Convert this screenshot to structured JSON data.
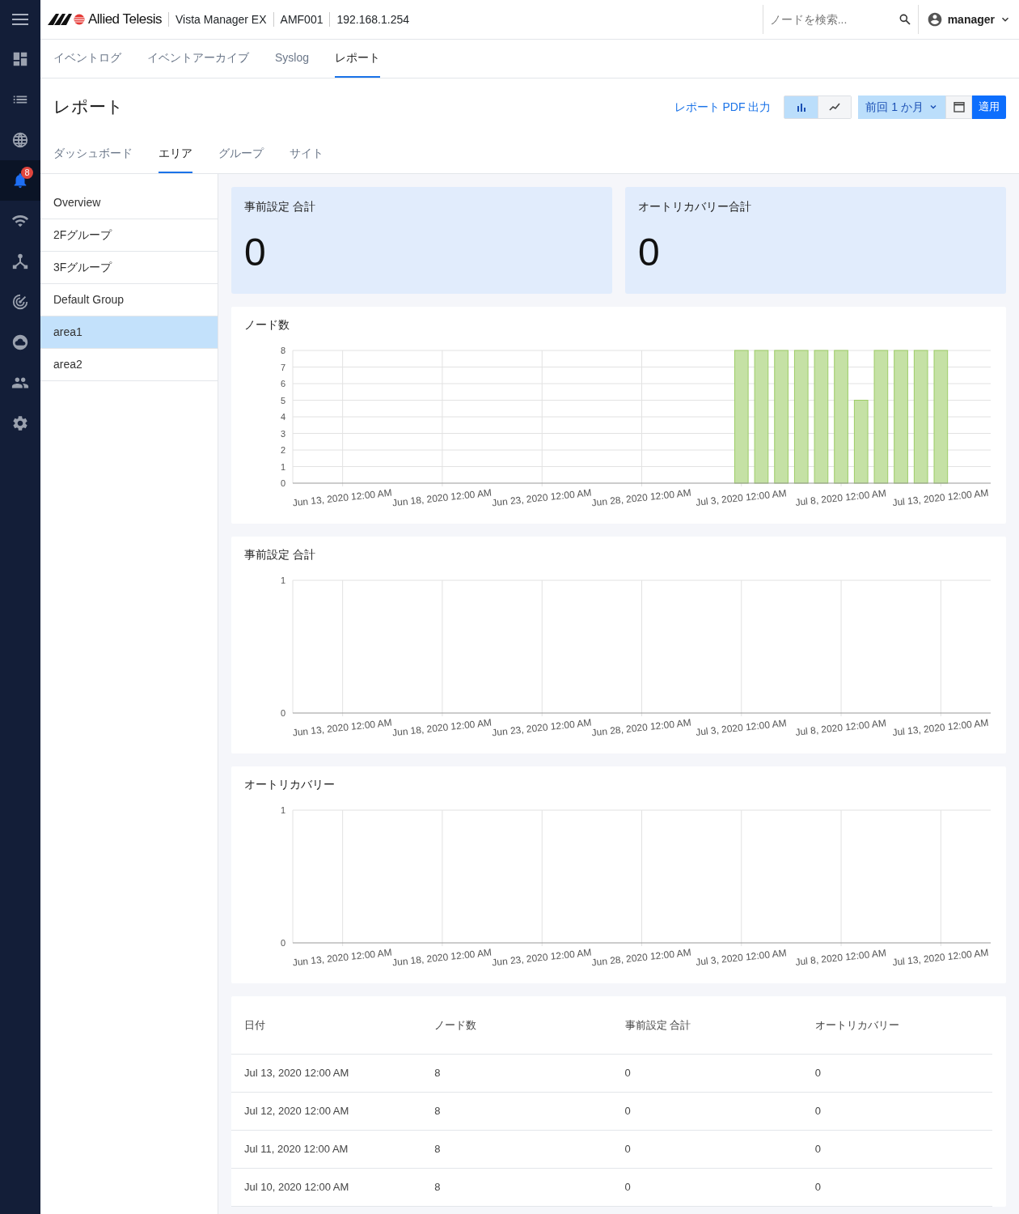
{
  "header": {
    "logo_text": "Allied Telesis",
    "app_name": "Vista Manager EX",
    "amf": "AMF001",
    "ip": "192.168.1.254",
    "search": {
      "placeholder": "ノードを検索..."
    },
    "user": "manager"
  },
  "nav_rail": [
    {
      "kind": "dashboard",
      "selected": false
    },
    {
      "kind": "list",
      "selected": false
    },
    {
      "kind": "globe",
      "selected": false
    },
    {
      "kind": "bell",
      "selected": true,
      "badge": "8"
    },
    {
      "kind": "wifi",
      "selected": false
    },
    {
      "kind": "topology",
      "selected": false
    },
    {
      "kind": "radar",
      "selected": false
    },
    {
      "kind": "cloud",
      "selected": false
    },
    {
      "kind": "people",
      "selected": false
    },
    {
      "kind": "settings",
      "selected": false
    }
  ],
  "tabs": [
    {
      "label": "イベントログ",
      "selected": false
    },
    {
      "label": "イベントアーカイブ",
      "selected": false
    },
    {
      "label": "Syslog",
      "selected": false
    },
    {
      "label": "レポート",
      "selected": true
    }
  ],
  "page_title": "レポート",
  "actions": {
    "pdf_link": "レポート PDF 出力",
    "chart_types": [
      {
        "kind": "bar",
        "selected": true
      },
      {
        "kind": "line",
        "selected": false
      }
    ],
    "range": "前回 1 か月",
    "apply": "適用"
  },
  "sub_tabs": [
    {
      "label": "ダッシュボード",
      "selected": false
    },
    {
      "label": "エリア",
      "selected": true
    },
    {
      "label": "グループ",
      "selected": false
    },
    {
      "label": "サイト",
      "selected": false
    }
  ],
  "groups": [
    {
      "label": "Overview",
      "selected": false
    },
    {
      "label": "2Fグループ",
      "selected": false
    },
    {
      "label": "3Fグループ",
      "selected": false
    },
    {
      "label": "Default Group",
      "selected": false
    },
    {
      "label": "area1",
      "selected": true
    },
    {
      "label": "area2",
      "selected": false
    }
  ],
  "summary_cards": [
    {
      "title": "事前設定 合計",
      "value": "0"
    },
    {
      "title": "オートリカバリー合計",
      "value": "0"
    }
  ],
  "charts": [
    {
      "title": "ノード数",
      "chart_data": {
        "type": "bar",
        "grid": true,
        "ylim": [
          0,
          8
        ],
        "yticks": [
          0,
          1,
          2,
          3,
          4,
          5,
          6,
          7,
          8
        ],
        "categories": [
          null,
          null,
          "Jun 13, 2020 12:00 AM",
          null,
          null,
          null,
          null,
          "Jun 18, 2020 12:00 AM",
          null,
          null,
          null,
          null,
          "Jun 23, 2020 12:00 AM",
          null,
          null,
          null,
          null,
          "Jun 28, 2020 12:00 AM",
          null,
          null,
          null,
          null,
          "Jul 3, 2020 12:00 AM",
          null,
          null,
          null,
          null,
          "Jul 8, 2020 12:00 AM",
          null,
          null,
          null,
          null,
          "Jul 13, 2020 12:00 AM",
          null,
          null
        ],
        "series": [
          {
            "color": "#c5e1a5",
            "values": [
              null,
              null,
              null,
              null,
              null,
              null,
              null,
              null,
              null,
              null,
              null,
              null,
              null,
              null,
              null,
              null,
              null,
              null,
              null,
              null,
              null,
              null,
              8,
              8,
              8,
              8,
              8,
              8,
              5,
              8,
              8,
              8,
              8,
              null,
              null
            ]
          }
        ]
      }
    },
    {
      "title": "事前設定 合計",
      "chart_data": {
        "type": "bar",
        "grid": true,
        "ylim": [
          0,
          1
        ],
        "yticks": [
          0,
          1
        ],
        "categories": [
          null,
          null,
          "Jun 13, 2020 12:00 AM",
          null,
          null,
          null,
          null,
          "Jun 18, 2020 12:00 AM",
          null,
          null,
          null,
          null,
          "Jun 23, 2020 12:00 AM",
          null,
          null,
          null,
          null,
          "Jun 28, 2020 12:00 AM",
          null,
          null,
          null,
          null,
          "Jul 3, 2020 12:00 AM",
          null,
          null,
          null,
          null,
          "Jul 8, 2020 12:00 AM",
          null,
          null,
          null,
          null,
          "Jul 13, 2020 12:00 AM",
          null,
          null
        ],
        "series": [
          {
            "values": [
              null,
              null,
              null,
              null,
              null,
              null,
              null,
              null,
              null,
              null,
              null,
              null,
              null,
              null,
              null,
              null,
              null,
              null,
              null,
              null,
              null,
              null,
              0,
              0,
              0,
              0,
              0,
              0,
              0,
              0,
              0,
              0,
              0,
              null,
              null
            ]
          }
        ]
      }
    },
    {
      "title": "オートリカバリー",
      "chart_data": {
        "type": "bar",
        "grid": true,
        "ylim": [
          0,
          1
        ],
        "yticks": [
          0,
          1
        ],
        "categories": [
          null,
          null,
          "Jun 13, 2020 12:00 AM",
          null,
          null,
          null,
          null,
          "Jun 18, 2020 12:00 AM",
          null,
          null,
          null,
          null,
          "Jun 23, 2020 12:00 AM",
          null,
          null,
          null,
          null,
          "Jun 28, 2020 12:00 AM",
          null,
          null,
          null,
          null,
          "Jul 3, 2020 12:00 AM",
          null,
          null,
          null,
          null,
          "Jul 8, 2020 12:00 AM",
          null,
          null,
          null,
          null,
          "Jul 13, 2020 12:00 AM",
          null,
          null
        ],
        "series": [
          {
            "values": [
              null,
              null,
              null,
              null,
              null,
              null,
              null,
              null,
              null,
              null,
              null,
              null,
              null,
              null,
              null,
              null,
              null,
              null,
              null,
              null,
              null,
              null,
              0,
              0,
              0,
              0,
              0,
              0,
              0,
              0,
              0,
              0,
              0,
              null,
              null
            ]
          }
        ]
      }
    }
  ],
  "table": {
    "columns": [
      "日付",
      "ノード数",
      "事前設定 合計",
      "オートリカバリー"
    ],
    "rows": [
      [
        "Jul 13, 2020 12:00 AM",
        "8",
        "0",
        "0"
      ],
      [
        "Jul 12, 2020 12:00 AM",
        "8",
        "0",
        "0"
      ],
      [
        "Jul 11, 2020 12:00 AM",
        "8",
        "0",
        "0"
      ],
      [
        "Jul 10, 2020 12:00 AM",
        "8",
        "0",
        "0"
      ]
    ]
  }
}
